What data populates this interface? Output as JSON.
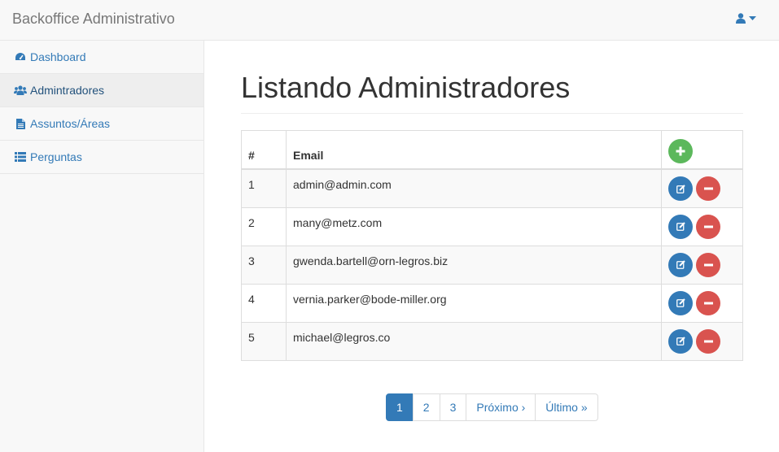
{
  "navbar": {
    "brand": "Backoffice Administrativo",
    "user_icon": "user-icon",
    "caret_icon": "caret-down-icon"
  },
  "sidebar": {
    "items": [
      {
        "label": "Dashboard",
        "icon": "dashboard-icon"
      },
      {
        "label": "Admintradores",
        "icon": "users-icon",
        "active": true
      },
      {
        "label": "Assuntos/Áreas",
        "icon": "file-icon"
      },
      {
        "label": "Perguntas",
        "icon": "list-icon"
      }
    ]
  },
  "main": {
    "title": "Listando Administradores",
    "table": {
      "headers": [
        "#",
        "Email"
      ],
      "rows": [
        {
          "id": "1",
          "email": "admin@admin.com"
        },
        {
          "id": "2",
          "email": "many@metz.com"
        },
        {
          "id": "3",
          "email": "gwenda.bartell@orn-legros.biz"
        },
        {
          "id": "4",
          "email": "vernia.parker@bode-miller.org"
        },
        {
          "id": "5",
          "email": "michael@legros.co"
        }
      ]
    },
    "pagination": {
      "pages": [
        "1",
        "2",
        "3"
      ],
      "current": "1",
      "next": "Próximo ›",
      "last": "Último »"
    }
  },
  "colors": {
    "primary": "#337ab7",
    "success": "#5cb85c",
    "danger": "#d9534f"
  }
}
